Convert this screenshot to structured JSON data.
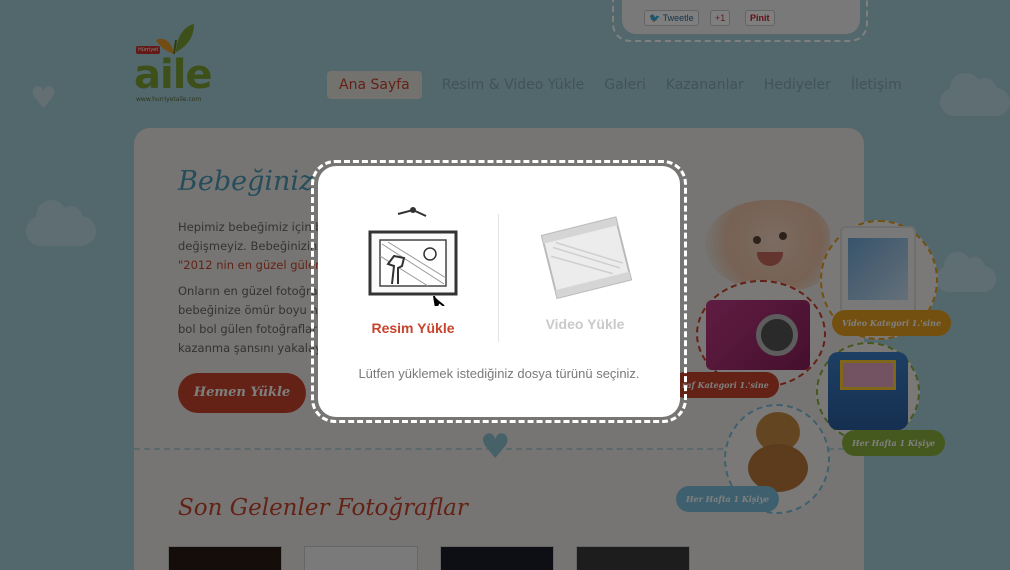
{
  "social": {
    "tweet": "Tweetle",
    "plus_one": "+1",
    "pin_it": "Pinit"
  },
  "logo": {
    "badge": "Hürriyet",
    "word": "aile",
    "url": "www.hurriyetaile.com"
  },
  "nav": {
    "items": [
      "Ana Sayfa",
      "Resim & Video Yükle",
      "Galeri",
      "Kazananlar",
      "Hediyeler",
      "İletişim"
    ]
  },
  "hero": {
    "title": "Bebeğiniz bir g",
    "para1": [
      "Hepimiz bebeğimiz için b",
      "değişmeyiz. Bebeğinizin c",
      "\"2012 nin en güzel gülen"
    ],
    "para2": [
      "Onların en güzel fotoğraf",
      "bebeğinize ömür boyu ha",
      "bol bol gülen fotoğrafları",
      "kazanma şansını yakalayı"
    ],
    "button": "Hemen Yükle"
  },
  "recent": {
    "title": "Son Gelenler Fotoğraflar"
  },
  "prizes": {
    "video_category": "Video Kategori 1.'sine",
    "photo_category": "raf Kategori 1.'sine",
    "weekly_1": "Her Hafta 1 Kişiye",
    "weekly_2": "Her Hafta 1 Kişiye"
  },
  "modal": {
    "image_option": "Resim Yükle",
    "video_option": "Video Yükle",
    "hint": "Lütfen yüklemek istediğiniz dosya türünü seçiniz."
  },
  "colors": {
    "accent_red": "#c8432c",
    "sky_blue": "#a6d0da",
    "leaf_green": "#7ba033",
    "prize_orange": "#e8a020",
    "prize_green": "#8bb13a",
    "prize_blue": "#7cc0dc"
  }
}
